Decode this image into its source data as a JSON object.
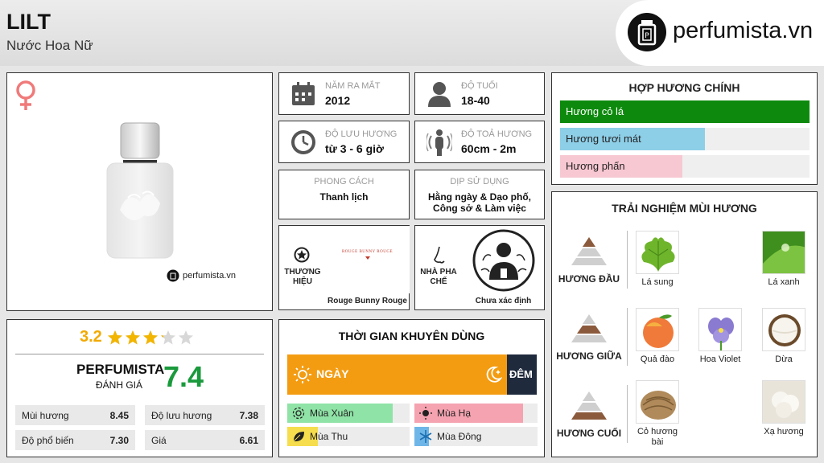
{
  "header": {
    "title": "LILT",
    "subtitle": "Nước Hoa Nữ",
    "logo_text": "perfumista.vn"
  },
  "product": {
    "watermark": "perfumista.vn",
    "gender_icon": "female-symbol-icon"
  },
  "rating": {
    "value": "3.2",
    "stars_filled": 3.2,
    "stars_total": 5,
    "brand_label": "PERFUMISTA",
    "sub_label": "ĐÁNH GIÁ",
    "score": "7.4",
    "metrics": [
      {
        "label": "Mùi hương",
        "value": "8.45"
      },
      {
        "label": "Độ lưu hương",
        "value": "7.38"
      },
      {
        "label": "Độ phổ biến",
        "value": "7.30"
      },
      {
        "label": "Giá",
        "value": "6.61"
      }
    ]
  },
  "info": {
    "release": {
      "label": "NĂM RA MẮT",
      "value": "2012",
      "icon": "calendar-icon"
    },
    "age": {
      "label": "ĐỘ TUỔI",
      "value": "18-40",
      "icon": "person-icon"
    },
    "longevity": {
      "label": "ĐỘ LƯU HƯƠNG",
      "value": "từ 3 - 6 giờ",
      "icon": "clock-icon"
    },
    "sillage": {
      "label": "ĐỘ TOẢ HƯƠNG",
      "value": "60cm - 2m",
      "icon": "radiate-icon"
    },
    "style": {
      "label": "PHONG CÁCH",
      "value": "Thanh lịch"
    },
    "occasion": {
      "label": "DỊP SỬ DỤNG",
      "value": "Hằng ngày & Dạo phố, Công sở & Làm việc"
    }
  },
  "brand": {
    "label": "THƯƠNG HIỆU",
    "logo_text": "ROUGE BUNNY ROUGE",
    "name": "Rouge Bunny Rouge"
  },
  "perfumer": {
    "label": "NHÀ PHA CHẾ",
    "name": "Chưa xác định"
  },
  "time": {
    "title": "THỜI GIAN KHUYÊN DÙNG",
    "day_label": "NGÀY",
    "night_label": "ĐÊM",
    "day_share": 0.88,
    "seasons": [
      {
        "label": "Mùa Xuân",
        "level": 0.86,
        "color": "#8fe3a6"
      },
      {
        "label": "Mùa Hạ",
        "level": 0.88,
        "color": "#f5a3b0"
      },
      {
        "label": "Mùa Thu",
        "level": 0.25,
        "color": "#f6dd4d"
      },
      {
        "label": "Mùa Đông",
        "level": 0.12,
        "color": "#6fb6e8"
      }
    ]
  },
  "accords": {
    "title": "HỢP HƯƠNG CHÍNH",
    "items": [
      {
        "label": "Hương cỏ lá",
        "level": 1.0,
        "color": "#0d8a0d",
        "text_color": "#ffffff"
      },
      {
        "label": "Hương tươi mát",
        "level": 0.58,
        "color": "#8ecfe8",
        "text_color": "#222222"
      },
      {
        "label": "Hương phấn",
        "level": 0.49,
        "color": "#f8c8d2",
        "text_color": "#222222"
      }
    ]
  },
  "notes": {
    "title": "TRẢI NGHIỆM MÙI HƯƠNG",
    "top": {
      "label": "HƯƠNG ĐẦU",
      "items": [
        "Lá sung",
        "Lá xanh"
      ]
    },
    "middle": {
      "label": "HƯƠNG GIỮA",
      "items": [
        "Quả đào",
        "Hoa Violet",
        "Dừa"
      ]
    },
    "base": {
      "label": "HƯƠNG CUỐI",
      "items": [
        "Cỏ hương bài",
        "Xạ hương"
      ]
    }
  }
}
